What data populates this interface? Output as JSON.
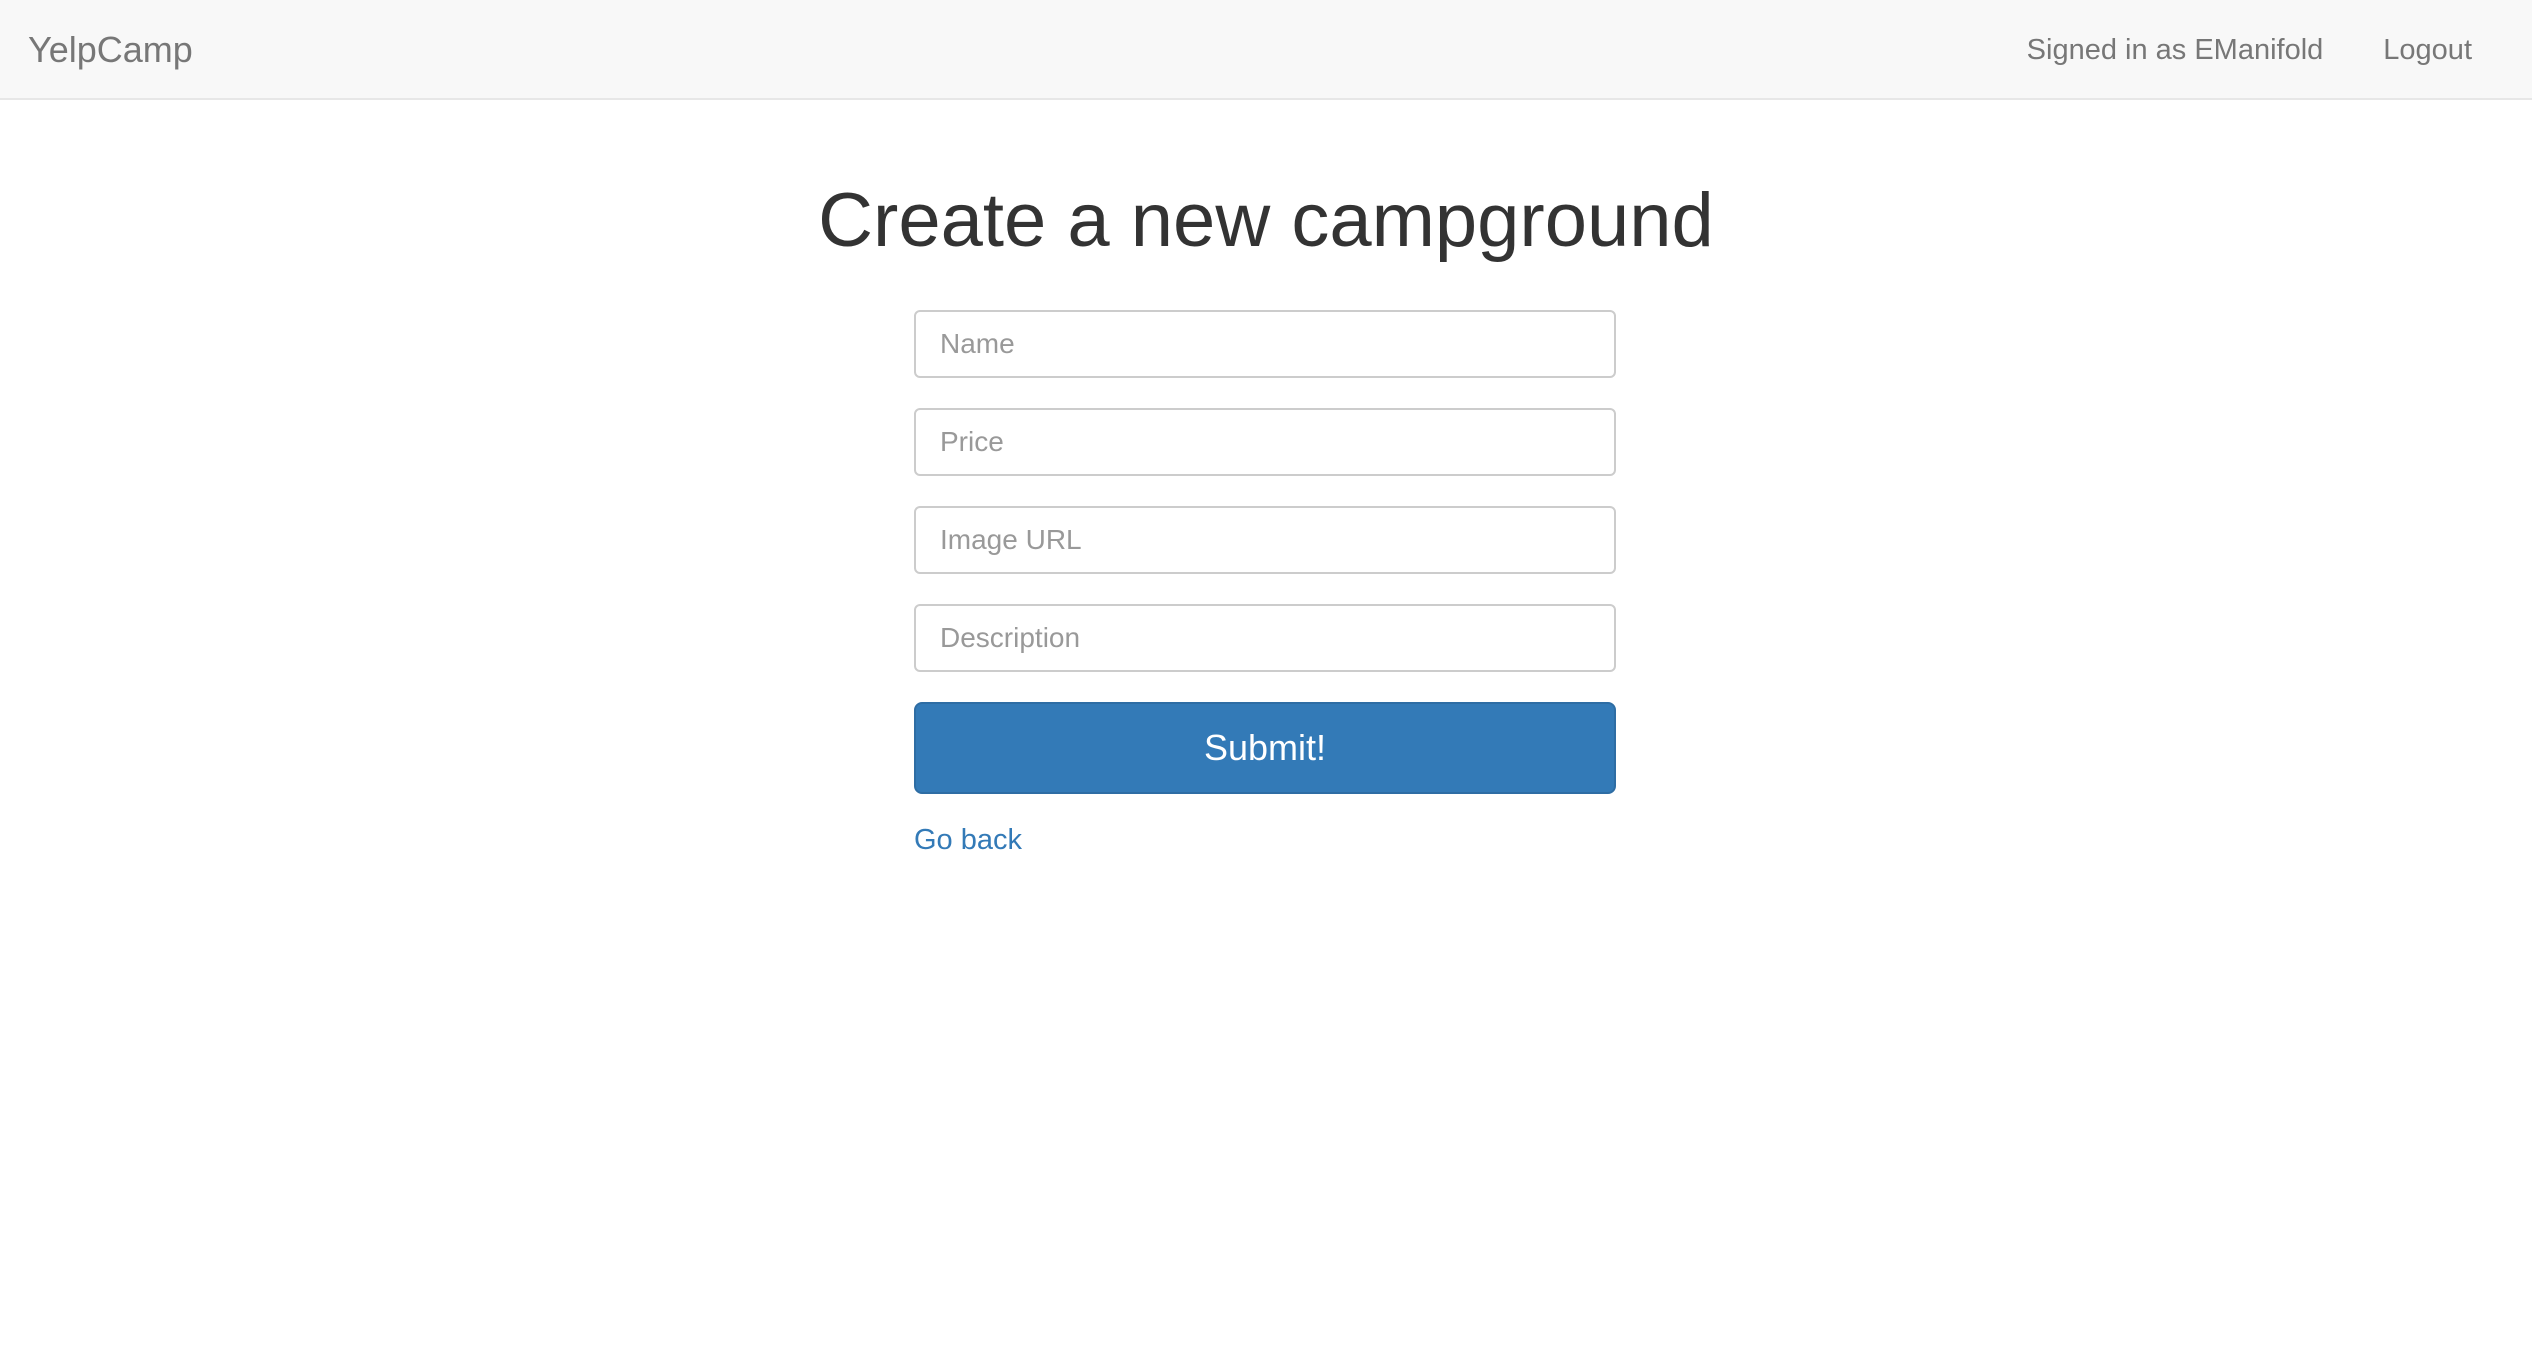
{
  "navbar": {
    "brand": "YelpCamp",
    "signed_in_text": "Signed in as EManifold",
    "logout_label": "Logout"
  },
  "page": {
    "title": "Create a new campground"
  },
  "form": {
    "name": {
      "placeholder": "Name",
      "value": ""
    },
    "price": {
      "placeholder": "Price",
      "value": ""
    },
    "image_url": {
      "placeholder": "Image URL",
      "value": ""
    },
    "description": {
      "placeholder": "Description",
      "value": ""
    },
    "submit_label": "Submit!",
    "go_back_label": "Go back"
  },
  "colors": {
    "navbar_bg": "#f8f8f8",
    "primary": "#337ab7",
    "link": "#337ab7",
    "nav_text": "#777777"
  }
}
